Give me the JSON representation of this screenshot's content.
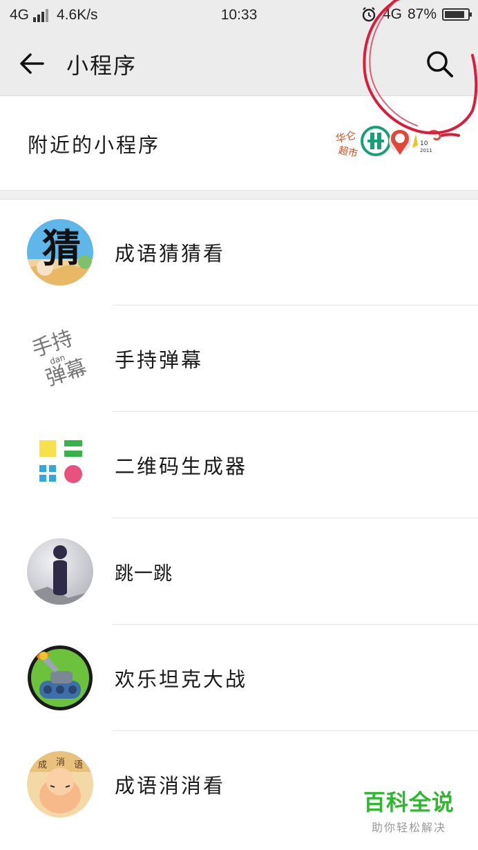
{
  "status_bar": {
    "network": "4G",
    "speed": "4.6K/s",
    "time": "10:33",
    "network_right": "4G",
    "battery": "87%"
  },
  "nav": {
    "title": "小程序",
    "back_icon": "arrow-left-icon",
    "search_icon": "search-icon"
  },
  "nearby": {
    "label": "附近的小程序"
  },
  "apps": [
    {
      "name": "成语猜猜看",
      "icon": "idiom-guess-icon"
    },
    {
      "name": "手持弹幕",
      "icon": "handheld-danmaku-icon"
    },
    {
      "name": "二维码生成器",
      "icon": "qrcode-generator-icon"
    },
    {
      "name": "跳一跳",
      "icon": "jump-game-icon"
    },
    {
      "name": "欢乐坦克大战",
      "icon": "tank-battle-icon"
    },
    {
      "name": "成语消消看",
      "icon": "idiom-match-icon"
    }
  ],
  "icon_text": {
    "idiom_guess_char": "猜",
    "danmaku_top": "手持",
    "danmaku_mid": "dan",
    "danmaku_bottom": "弹幕",
    "idiom_match_chars": [
      "成",
      "消",
      "语"
    ],
    "nearby_logo_text": [
      "华仑",
      "超市"
    ]
  },
  "watermark": {
    "title": "百科全说",
    "subtitle": "助你轻松解决"
  },
  "colors": {
    "header_bg": "#ececed",
    "annotation": "#d81e3a",
    "watermark_green": "#2db82d"
  }
}
